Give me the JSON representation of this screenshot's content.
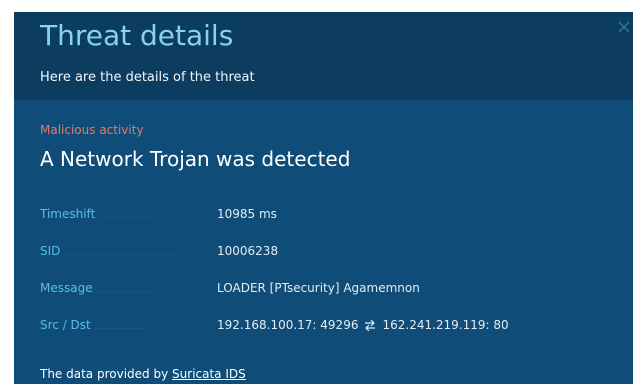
{
  "dialog": {
    "title": "Threat details",
    "subtitle": "Here are the details of the threat",
    "close_icon": "close-icon",
    "category": "Malicious activity",
    "threat_name": "A Network Trojan was detected",
    "details": [
      {
        "label": "Timeshift",
        "value": "10985 ms"
      },
      {
        "label": "SID",
        "value": "10006238"
      },
      {
        "label": "Message",
        "value": "LOADER [PTsecurity] Agamemnon"
      },
      {
        "label": "Src / Dst",
        "src": "192.168.100.17: 49296",
        "dst": "162.241.219.119: 80"
      }
    ],
    "footer_prefix": "The data provided by",
    "footer_link": "Suricata IDS"
  },
  "colors": {
    "background": "#0f4d78",
    "header_background": "#0c3d60",
    "title": "#85d3f0",
    "category": "#e87863",
    "label": "#58bde7"
  }
}
